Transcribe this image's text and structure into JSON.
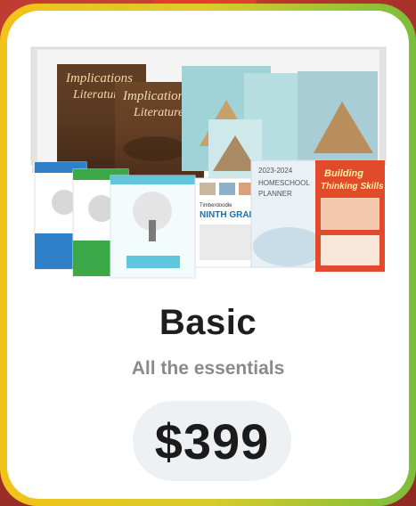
{
  "card": {
    "title": "Basic",
    "subtitle": "All the essentials",
    "price": "$399"
  },
  "books": {
    "implications_1": "Implications",
    "literature_1": "Literature",
    "implications_2": "Implications",
    "literature_2": "Literature",
    "planner_year": "2023-2024",
    "planner_line1": "HOMESCHOOL",
    "planner_line2": "PLANNER",
    "ninth_grade_brand": "Timberdoodle",
    "ninth_grade": "NINTH GRADE",
    "bts_line1": "Building",
    "bts_line2": "Thinking Skills"
  },
  "colors": {
    "border_start": "#f2c318",
    "border_end": "#7cbd3c",
    "card_bg": "#ffffff",
    "title": "#1e1e1e",
    "subtitle": "#8a8a8a",
    "price_bg": "#eef1f4"
  }
}
